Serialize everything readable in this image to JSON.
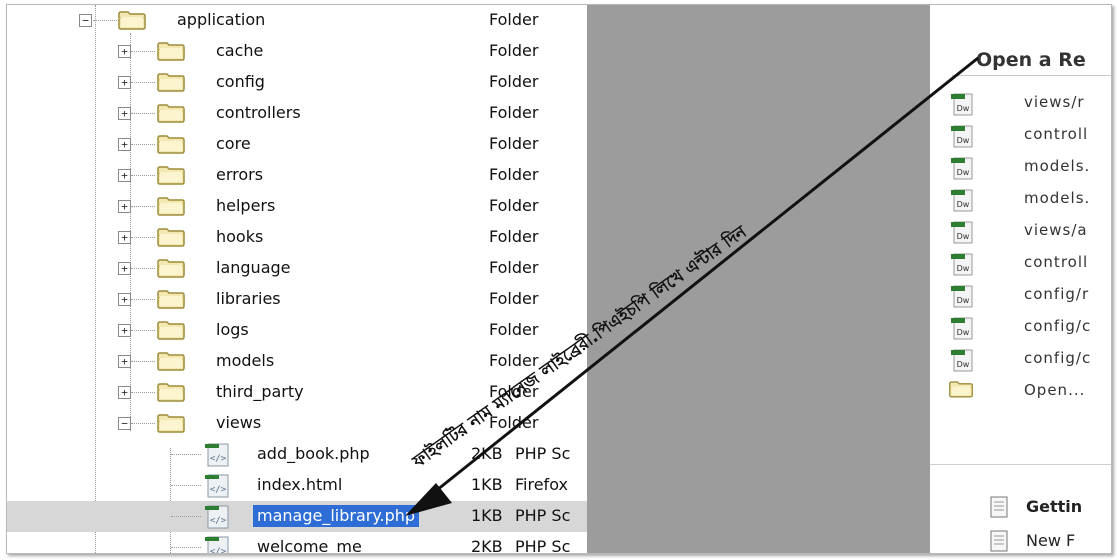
{
  "tree": {
    "rows": [
      {
        "name": "application",
        "type": "Folder",
        "kind": "folder",
        "expander": "−"
      },
      {
        "name": "cache",
        "type": "Folder",
        "kind": "folder",
        "expander": "+"
      },
      {
        "name": "config",
        "type": "Folder",
        "kind": "folder",
        "expander": "+"
      },
      {
        "name": "controllers",
        "type": "Folder",
        "kind": "folder",
        "expander": "+"
      },
      {
        "name": "core",
        "type": "Folder",
        "kind": "folder",
        "expander": "+"
      },
      {
        "name": "errors",
        "type": "Folder",
        "kind": "folder",
        "expander": "+"
      },
      {
        "name": "helpers",
        "type": "Folder",
        "kind": "folder",
        "expander": "+"
      },
      {
        "name": "hooks",
        "type": "Folder",
        "kind": "folder",
        "expander": "+"
      },
      {
        "name": "language",
        "type": "Folder",
        "kind": "folder",
        "expander": "+"
      },
      {
        "name": "libraries",
        "type": "Folder",
        "kind": "folder",
        "expander": "+"
      },
      {
        "name": "logs",
        "type": "Folder",
        "kind": "folder",
        "expander": "+"
      },
      {
        "name": "models",
        "type": "Folder",
        "kind": "folder",
        "expander": "+"
      },
      {
        "name": "third_party",
        "type": "Folder",
        "kind": "folder",
        "expander": "+"
      },
      {
        "name": "views",
        "type": "Folder",
        "kind": "folder",
        "expander": "−"
      },
      {
        "name": "add_book.php",
        "size": "2KB",
        "type": "PHP Sc",
        "kind": "file"
      },
      {
        "name": "index.html",
        "size": "1KB",
        "type": "Firefox",
        "kind": "file"
      },
      {
        "name": "manage_library.php",
        "size": "1KB",
        "type": "PHP Sc",
        "kind": "file",
        "selected": true
      },
      {
        "name": "welcome_me",
        "size": "2KB",
        "type": "PHP Sc",
        "kind": "file"
      }
    ]
  },
  "start_panel": {
    "title": "Open a Re",
    "recent": [
      {
        "label": "views/r",
        "icon": "dw-file-icon"
      },
      {
        "label": "controll",
        "icon": "dw-file-icon"
      },
      {
        "label": "models.",
        "icon": "dw-file-icon"
      },
      {
        "label": "models.",
        "icon": "dw-file-icon"
      },
      {
        "label": "views/a",
        "icon": "dw-file-icon"
      },
      {
        "label": "controll",
        "icon": "dw-file-icon"
      },
      {
        "label": "config/r",
        "icon": "dw-file-icon"
      },
      {
        "label": "config/c",
        "icon": "dw-file-icon"
      },
      {
        "label": "config/c",
        "icon": "dw-file-icon"
      },
      {
        "label": "Open...",
        "icon": "folder-icon"
      }
    ],
    "icon_badge": "Dw",
    "bottom": [
      {
        "label": "Gettin",
        "bold": true
      },
      {
        "label": "New F",
        "bold": false
      }
    ]
  },
  "annotation": {
    "text": "ফাইলটির নাম ম্যানেজ লাইব্রেরী.পিএইচপি লিখে এন্টার দিন"
  },
  "colors": {
    "selection": "#2f6dd6",
    "divider": "#9c9c9c",
    "folder_fill": "#f3e9b0",
    "folder_stroke": "#9e8c3a",
    "dw_green": "#2e7d32"
  }
}
